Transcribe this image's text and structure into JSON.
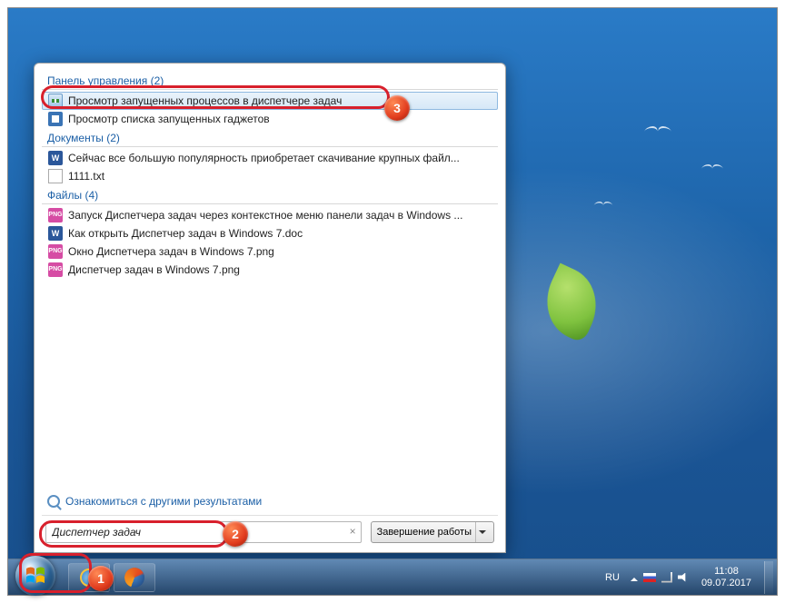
{
  "groups": {
    "control_panel": {
      "header": "Панель управления (2)"
    },
    "documents": {
      "header": "Документы (2)"
    },
    "files": {
      "header": "Файлы (4)"
    }
  },
  "results": {
    "cp1": "Просмотр запущенных процессов в диспетчере задач",
    "cp2": "Просмотр списка запущенных гаджетов",
    "doc1": "Сейчас все большую популярность приобретает скачивание крупных файл...",
    "doc2": "1111.txt",
    "f1": "Запуск Диспетчера задач через контекстное меню панели задач в Windows ...",
    "f2": "Как открыть Диспетчер задач в Windows 7.doc",
    "f3": "Окно Диспетчера задач в Windows 7.png",
    "f4": "Диспетчер задач в Windows 7.png"
  },
  "more_results_label": "Ознакомиться с другими результатами",
  "search": {
    "value": "Диспетчер задач",
    "clear": "×"
  },
  "shutdown_label": "Завершение работы",
  "tray": {
    "lang": "RU",
    "time": "11:08",
    "date": "09.07.2017"
  },
  "annotations": {
    "b1": "1",
    "b2": "2",
    "b3": "3"
  }
}
